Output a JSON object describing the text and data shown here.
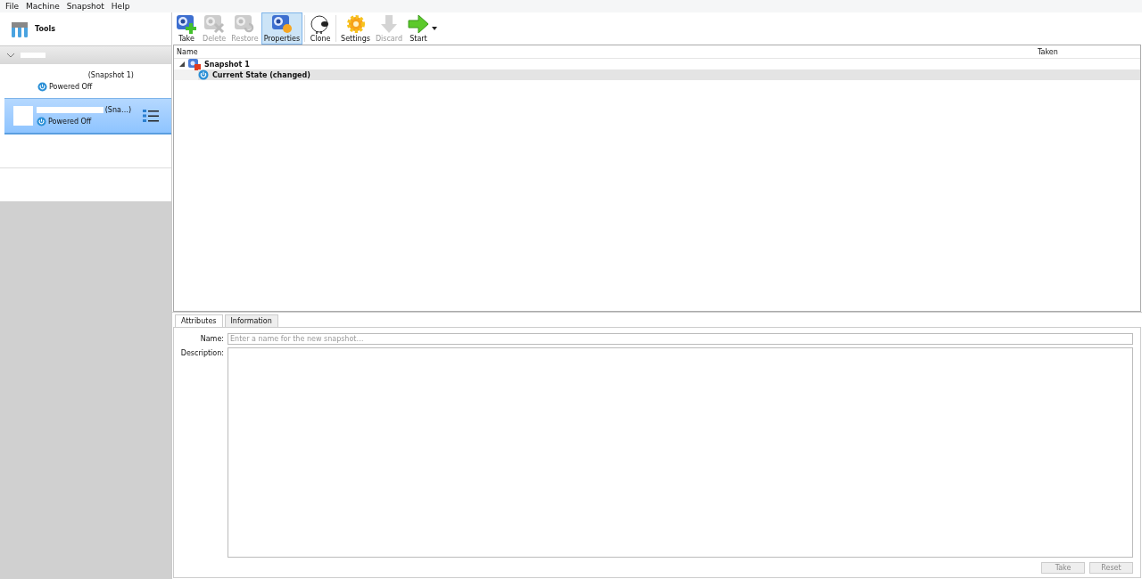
{
  "menu": [
    "File",
    "Machine",
    "Snapshot",
    "Help"
  ],
  "sidebar": {
    "tools_label": "Tools",
    "vms": [
      {
        "snapshot": "(Snapshot 1)",
        "state": "Powered Off",
        "selected": false
      },
      {
        "snapshot": "(Sna…)",
        "state": "Powered Off",
        "selected": true
      }
    ]
  },
  "toolbar": [
    {
      "kind": "take",
      "label": "Take",
      "disabled": false,
      "selected": false
    },
    {
      "kind": "delete",
      "label": "Delete",
      "disabled": true,
      "selected": false
    },
    {
      "kind": "restore",
      "label": "Restore",
      "disabled": true,
      "selected": false
    },
    {
      "kind": "properties",
      "label": "Properties",
      "disabled": false,
      "selected": true
    },
    {
      "kind": "clone",
      "label": "Clone",
      "disabled": false,
      "selected": false
    },
    {
      "kind": "settings",
      "label": "Settings",
      "disabled": false,
      "selected": false
    },
    {
      "kind": "discard",
      "label": "Discard",
      "disabled": true,
      "selected": false
    },
    {
      "kind": "start",
      "label": "Start",
      "disabled": false,
      "selected": false
    }
  ],
  "tree": {
    "columns": [
      "Name",
      "Taken"
    ],
    "rows": [
      {
        "label": "Snapshot 1",
        "expanded": true,
        "selected": false,
        "children": [
          {
            "label": "Current State (changed)",
            "selected": true
          }
        ]
      }
    ]
  },
  "tabs": [
    {
      "label": "Attributes",
      "selected": true
    },
    {
      "label": "Information",
      "selected": false
    }
  ],
  "form": {
    "name_label": "Name:",
    "name_placeholder": "Enter a name for the new snapshot…",
    "description_label": "Description:"
  },
  "buttons": [
    {
      "label": "Take",
      "disabled": true
    },
    {
      "label": "Reset",
      "disabled": true
    }
  ]
}
